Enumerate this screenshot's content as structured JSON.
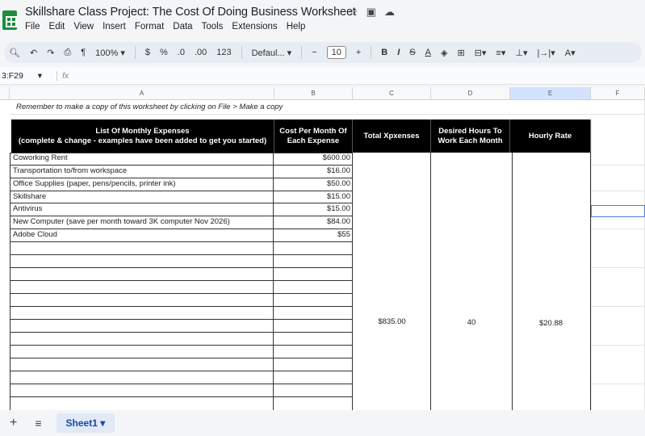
{
  "app": {
    "title": "Skillshare Class Project: The Cost Of Doing Business Worksheet",
    "icons": [
      "star-icon",
      "folder-icon",
      "cloud-icon"
    ]
  },
  "menu": [
    "File",
    "Edit",
    "View",
    "Insert",
    "Format",
    "Data",
    "Tools",
    "Extensions",
    "Help"
  ],
  "toolbar": {
    "zoom": "100%",
    "currency": "$",
    "percent": "%",
    "dec_decrease": ".0",
    "dec_increase": ".00",
    "number_format": "123",
    "font": "Defaul...",
    "font_size": "10",
    "bold": "B",
    "italic": "I",
    "text_color": "A"
  },
  "formula_bar": {
    "name_box": "3:F29",
    "fx": "fx"
  },
  "columns": [
    "A",
    "B",
    "C",
    "D",
    "E",
    "F"
  ],
  "sheet": {
    "note": "Remember to make a copy of this worksheet by clicking on File > Make a copy",
    "headers": {
      "a": "List Of Monthly Expenses\n(complete & change - examples have been added to get you started)",
      "b": "Cost Per Month Of Each Expense",
      "c": "Total Xpxenses",
      "d": "Desired Hours To Work Each Month",
      "e": "Hourly Rate"
    },
    "expenses": [
      {
        "name": "Coworking Rent",
        "cost": "$600.00"
      },
      {
        "name": "Transportation to/from workspace",
        "cost": "$16.00"
      },
      {
        "name": "Office Supplies (paper, pens/pencils, printer ink)",
        "cost": "$50.00"
      },
      {
        "name": "Skillshare",
        "cost": "$15.00"
      },
      {
        "name": "Antivirus",
        "cost": "$15.00"
      },
      {
        "name": "New Computer (save per month toward 3K computer Nov 2026)",
        "cost": "$84.00"
      },
      {
        "name": "Adobe Cloud",
        "cost": "$55"
      }
    ],
    "total": "$835.00",
    "hours": "40",
    "rate": "$20.88"
  },
  "sheets": {
    "active": "Sheet1"
  },
  "colors": {
    "accent": "#1a47a3",
    "header_bg": "#000000",
    "logo": "#1e8e3e"
  }
}
